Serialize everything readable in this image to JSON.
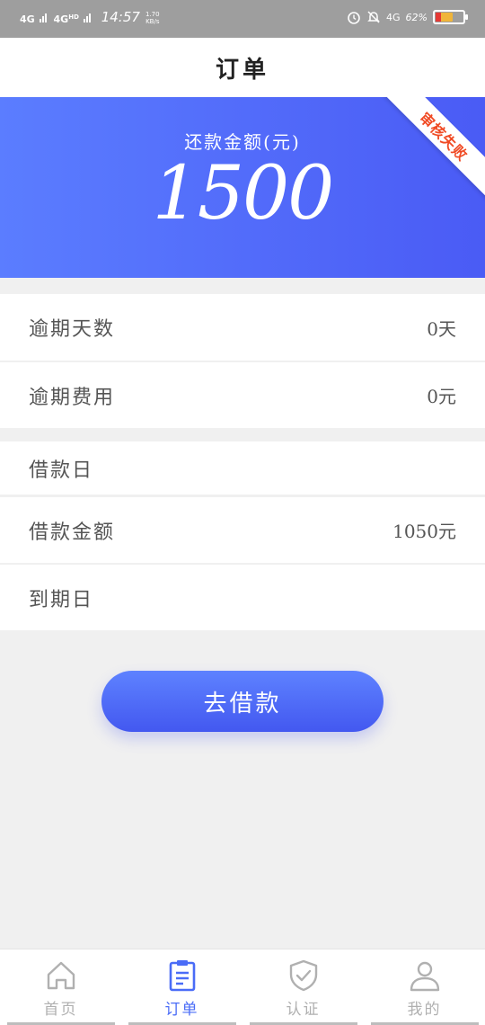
{
  "status_bar": {
    "network1": "4G",
    "network2": "4G",
    "network2_suffix": "HD",
    "time": "14:57",
    "speed_value": "1.70",
    "speed_unit": "KB/s",
    "network3": "4G",
    "battery_pct": "62%"
  },
  "header": {
    "title": "订单"
  },
  "banner": {
    "amount_label": "还款金额(元)",
    "amount_value": "1500",
    "status_ribbon": "审核失败",
    "gradient_start": "#5b7dff",
    "gradient_end": "#4a5bf5",
    "ribbon_text_color": "#f04a24"
  },
  "rows": [
    {
      "label": "逾期天数",
      "value": "0天"
    },
    {
      "label": "逾期费用",
      "value": "0元"
    },
    {
      "label": "借款日",
      "value": ""
    },
    {
      "label": "借款金额",
      "value": "1050元"
    },
    {
      "label": "到期日",
      "value": ""
    }
  ],
  "action": {
    "borrow_label": "去借款"
  },
  "nav": {
    "items": [
      {
        "label": "首页",
        "icon": "home-icon",
        "active": false
      },
      {
        "label": "订单",
        "icon": "clipboard-icon",
        "active": true
      },
      {
        "label": "认证",
        "icon": "shield-check-icon",
        "active": false
      },
      {
        "label": "我的",
        "icon": "user-icon",
        "active": false
      }
    ],
    "active_color": "#4a6cf7",
    "inactive_color": "#b0b0b0"
  }
}
